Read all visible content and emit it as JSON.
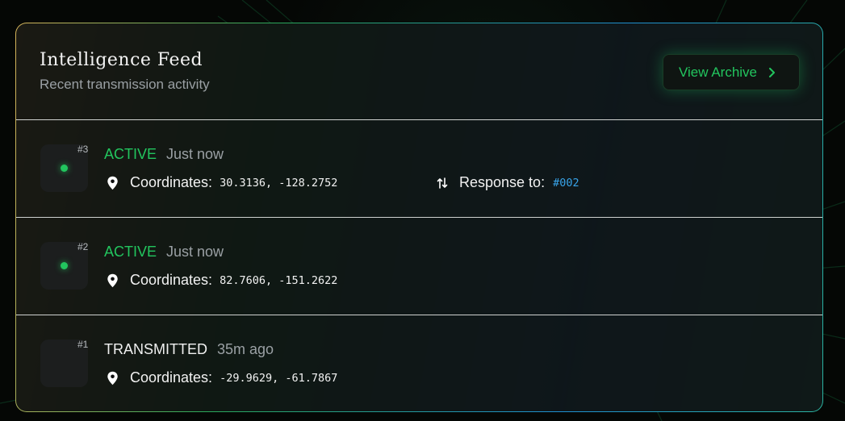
{
  "header": {
    "title": "Intelligence Feed",
    "subtitle": "Recent transmission activity",
    "archive_label": "View Archive"
  },
  "colors": {
    "accent": "#22c55e",
    "link": "#38a3e8",
    "border_gold": "#d6b45a",
    "border_blue": "#1f8fd0"
  },
  "feed": [
    {
      "number": "#3",
      "status": "ACTIVE",
      "time": "Just now",
      "coordinates_label": "Coordinates:",
      "coordinates": "30.3136, -128.2752",
      "response_label": "Response to:",
      "response_ref": "#002"
    },
    {
      "number": "#2",
      "status": "ACTIVE",
      "time": "Just now",
      "coordinates_label": "Coordinates:",
      "coordinates": "82.7606, -151.2622"
    },
    {
      "number": "#1",
      "status": "TRANSMITTED",
      "time": "35m ago",
      "coordinates_label": "Coordinates:",
      "coordinates": "-29.9629, -61.7867"
    }
  ]
}
